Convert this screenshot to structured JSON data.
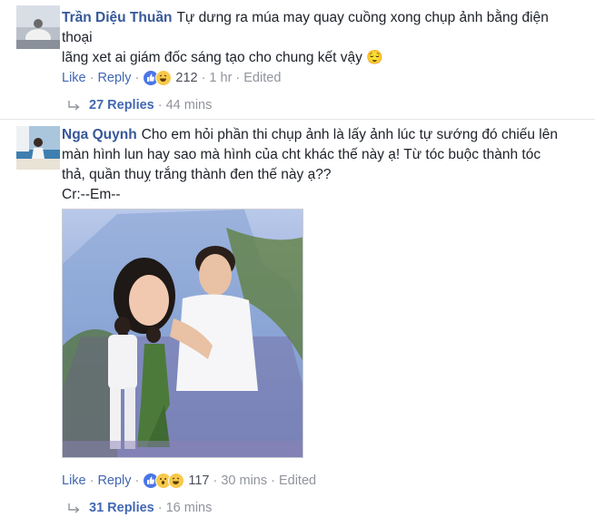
{
  "comments": [
    {
      "author": "Trần Diệu Thuần",
      "line1": "Tự dưng ra múa may quay cuồng xong chụp ảnh bằng điện",
      "line2": "thoại",
      "line3": "lãng xet ai giám đốc sáng tạo cho chung kết vậy",
      "emoji": "😌",
      "like_label": "Like",
      "reply_label": "Reply",
      "reaction_count": "212",
      "time": "1 hr",
      "edited": "Edited",
      "replies_label": "27 Replies",
      "replies_time": "44 mins"
    },
    {
      "author": "Nga Quynh",
      "line1": "Cho em hỏi phần thi chụp ảnh là lấy ảnh lúc tự sướng đó chiếu lên",
      "line2": "màn hình lun hay sao mà hình của cht khác thế này ạ! Từ tóc buộc thành tóc",
      "line3": "thả, quần thuỵ trắng thành đen thế này ạ??",
      "line4": "Cr:--Em--",
      "like_label": "Like",
      "reply_label": "Reply",
      "reaction_count": "117",
      "time": "30 mins",
      "edited": "Edited",
      "replies_label": "31 Replies",
      "replies_time": "16 mins"
    }
  ],
  "colors": {
    "author": "#365899",
    "link": "#4267b2",
    "meta": "#90949c",
    "like_reaction": "#4a76e8",
    "haha_reaction": "#f7c94a",
    "wow_reaction": "#f7c94a"
  },
  "icons": {
    "reply_arrow": "reply-arrow-icon",
    "like": "like-reaction-icon",
    "haha": "haha-reaction-icon",
    "wow": "wow-reaction-icon"
  }
}
